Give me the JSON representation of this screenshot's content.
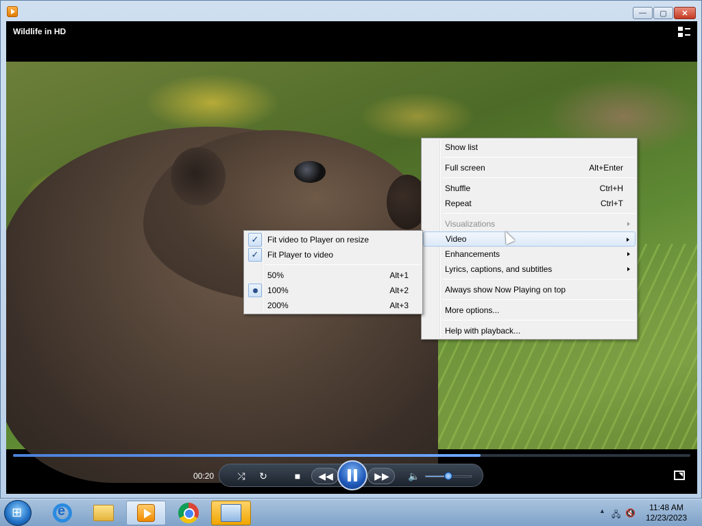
{
  "window": {
    "minimize": "—",
    "maximize": "▢",
    "close": "✕"
  },
  "player": {
    "title": "Wildlife in HD",
    "time": "00:20",
    "progress": 0.69,
    "volume": 0.5,
    "icons": [
      "switch-layout-icon",
      "shuffle-icon",
      "repeat-icon",
      "stop-icon",
      "previous-icon",
      "pause-icon",
      "next-icon",
      "volume-icon",
      "fullscreen-icon"
    ]
  },
  "context_menu": {
    "items": [
      {
        "label": "Show list",
        "shortcut": ""
      },
      {
        "label": "Full screen",
        "shortcut": "Alt+Enter"
      },
      {
        "label": "Shuffle",
        "shortcut": "Ctrl+H"
      },
      {
        "label": "Repeat",
        "shortcut": "Ctrl+T"
      },
      {
        "label": "Visualizations",
        "shortcut": ""
      },
      {
        "label": "Video",
        "shortcut": ""
      },
      {
        "label": "Enhancements",
        "shortcut": ""
      },
      {
        "label": "Lyrics, captions, and subtitles",
        "shortcut": ""
      },
      {
        "label": "Always show Now Playing on top",
        "shortcut": ""
      },
      {
        "label": "More options...",
        "shortcut": ""
      },
      {
        "label": "Help with playback...",
        "shortcut": ""
      }
    ]
  },
  "video_submenu": {
    "items": [
      {
        "label": "Fit video to Player on resize",
        "shortcut": "",
        "checked": true
      },
      {
        "label": "Fit Player to video",
        "shortcut": "",
        "checked": true
      },
      {
        "label": "50%",
        "shortcut": "Alt+1"
      },
      {
        "label": "100%",
        "shortcut": "Alt+2",
        "selected": true
      },
      {
        "label": "200%",
        "shortcut": "Alt+3"
      }
    ]
  },
  "taskbar": {
    "apps": [
      "start-button",
      "internet-explorer",
      "windows-explorer",
      "windows-media-player",
      "google-chrome",
      "control-panel"
    ],
    "tray_arrow": "▲",
    "time": "11:48 AM",
    "date": "12/23/2023"
  }
}
